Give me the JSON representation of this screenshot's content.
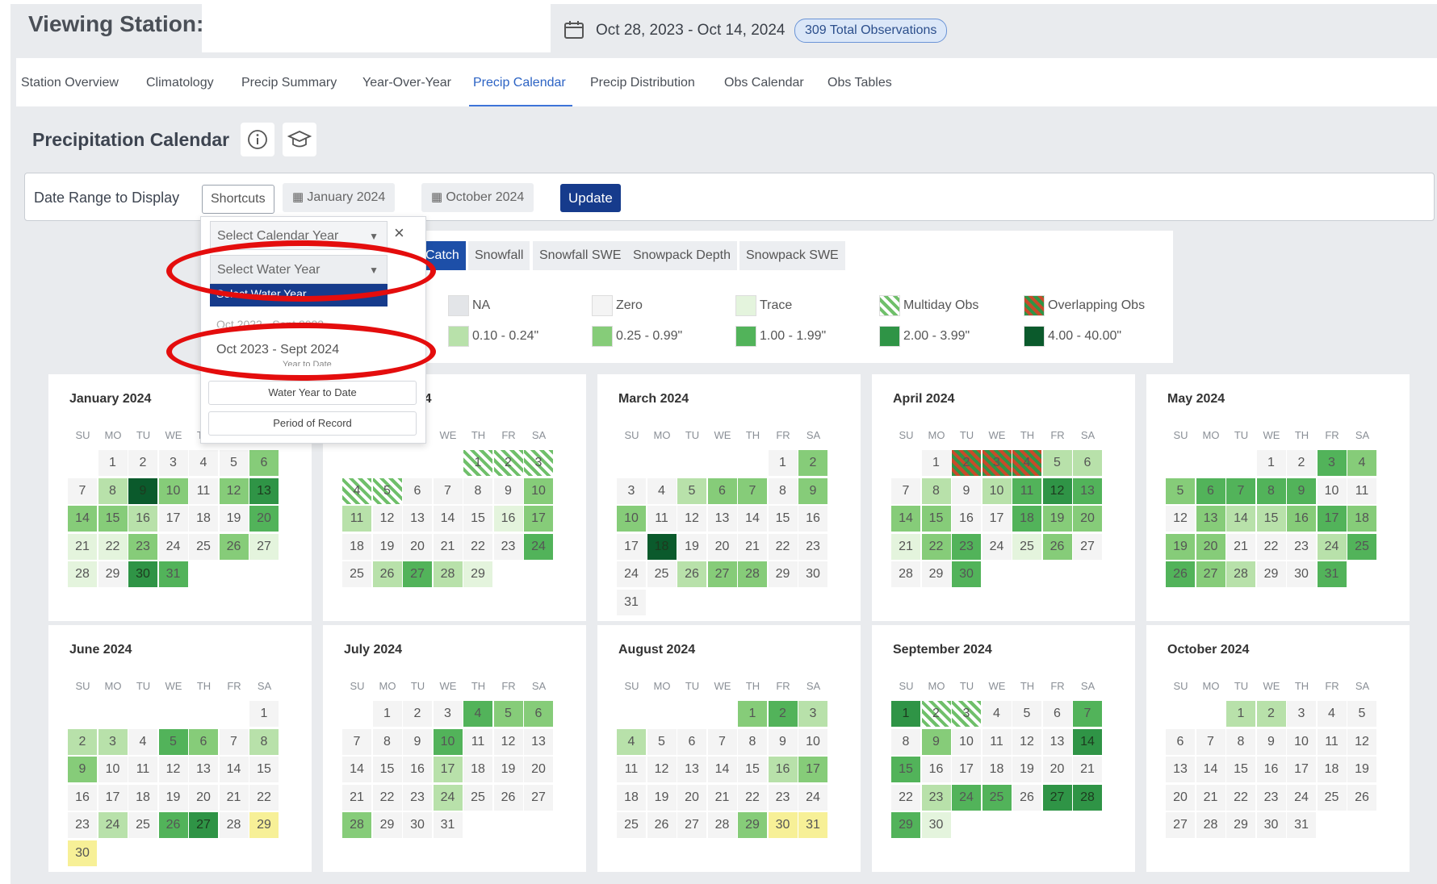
{
  "header": {
    "title": "Viewing Station:",
    "date_range": "Oct 28, 2023 - Oct 14, 2024",
    "badge": "309 Total Observations"
  },
  "tabs": [
    "Station Overview",
    "Climatology",
    "Precip Summary",
    "Year-Over-Year",
    "Precip Calendar",
    "Precip Distribution",
    "Obs Calendar",
    "Obs Tables"
  ],
  "active_tab": "Precip Calendar",
  "page_title": "Precipitation Calendar",
  "range": {
    "label": "Date Range to Display",
    "shortcuts": "Shortcuts",
    "start": "January 2024",
    "end": "October 2024",
    "update": "Update"
  },
  "dropdown": {
    "calendar_year_placeholder": "Select Calendar Year",
    "water_year_placeholder": "Select Water Year",
    "highlighted": "Select Water Year",
    "partial_option": "Oct 2022 - Sept 2023",
    "option": "Oct 2023 - Sept 2024",
    "partial_option_2": "Year to Date",
    "water_year_to_date": "Water Year to Date",
    "period_of_record": "Period of Record",
    "close": "×"
  },
  "chips": [
    "Catch",
    "Snowfall",
    "Snowfall SWE",
    "Snowpack Depth",
    "Snowpack SWE"
  ],
  "active_chip": "Catch",
  "legend": [
    {
      "label": "NA",
      "color": "#e3e5e8"
    },
    {
      "label": "Zero",
      "color": "#f4f4f4"
    },
    {
      "label": "Trace",
      "color": "#e4f4dd"
    },
    {
      "label": "Multiday Obs",
      "color": "hatch-green"
    },
    {
      "label": "Overlapping Obs",
      "color": "hatch-red"
    },
    {
      "label": "0.10 - 0.24\"",
      "color": "#b8e1aa"
    },
    {
      "label": "0.25 - 0.99\"",
      "color": "#86cc79"
    },
    {
      "label": "1.00 - 1.99\"",
      "color": "#52b35a"
    },
    {
      "label": "2.00 - 3.99\"",
      "color": "#2f9446"
    },
    {
      "label": "4.00 - 40.00\"",
      "color": "#0b5a2c"
    }
  ],
  "dow": [
    "SU",
    "MO",
    "TU",
    "WE",
    "TH",
    "FR",
    "SA"
  ],
  "palette": {
    "e": "#f4f4f4",
    "t": "#e4f4dd",
    "a": "#b8e1aa",
    "b": "#86cc79",
    "c": "#52b35a",
    "d": "#2f9446",
    "x": "#0b5a2c",
    "y": "#f7f097",
    "m": "hatch-green",
    "o": "hatch-red"
  },
  "months": [
    {
      "name": "January 2024",
      "offset": 1,
      "days": 31,
      "cells": "eeeeeb eaxbebdbbaeeecttbeebttedcbmmmm"
    },
    {
      "name": "February 2024",
      "offset": 4,
      "days": 29,
      "cells": "mmmmmeeeebaeeeetbeeeeeeceacat"
    },
    {
      "name": "March 2024",
      "offset": 5,
      "days": 31,
      "cells": "ebeeabbebbeeeeeeexeeeeeeeabbeeeb"
    },
    {
      "name": "April 2024",
      "offset": 1,
      "days": 30,
      "cells": "eoooaaeaeacdcbbeecbbtbcetbeeecc"
    },
    {
      "name": "May 2024",
      "offset": 3,
      "days": 31,
      "cells": "eecbbcccceeebaabcbbbeeeaccbaeeccee"
    },
    {
      "name": "June 2024",
      "offset": 6,
      "days": 30,
      "cells": "eaaecbeabeeeeeeeeeeeeeeaecdeyy"
    },
    {
      "name": "July 2024",
      "offset": 1,
      "days": 31,
      "cells": "eeecbbeeeceeeeeeaeeeeeeaeeebee"
    },
    {
      "name": "August 2024",
      "offset": 4,
      "days": 31,
      "cells": "bcaaeeeeeeeeeeeabeeeeeeeeeeebyyy"
    },
    {
      "name": "September 2024",
      "offset": 0,
      "days": 30,
      "cells": "dmmeeecebeeeedceeeeeeeacceddcte"
    },
    {
      "name": "October 2024",
      "offset": 2,
      "days": 31,
      "cells": "aaeeeeeeeeeeeeeeeeeeeeeeeeeeeee"
    }
  ]
}
